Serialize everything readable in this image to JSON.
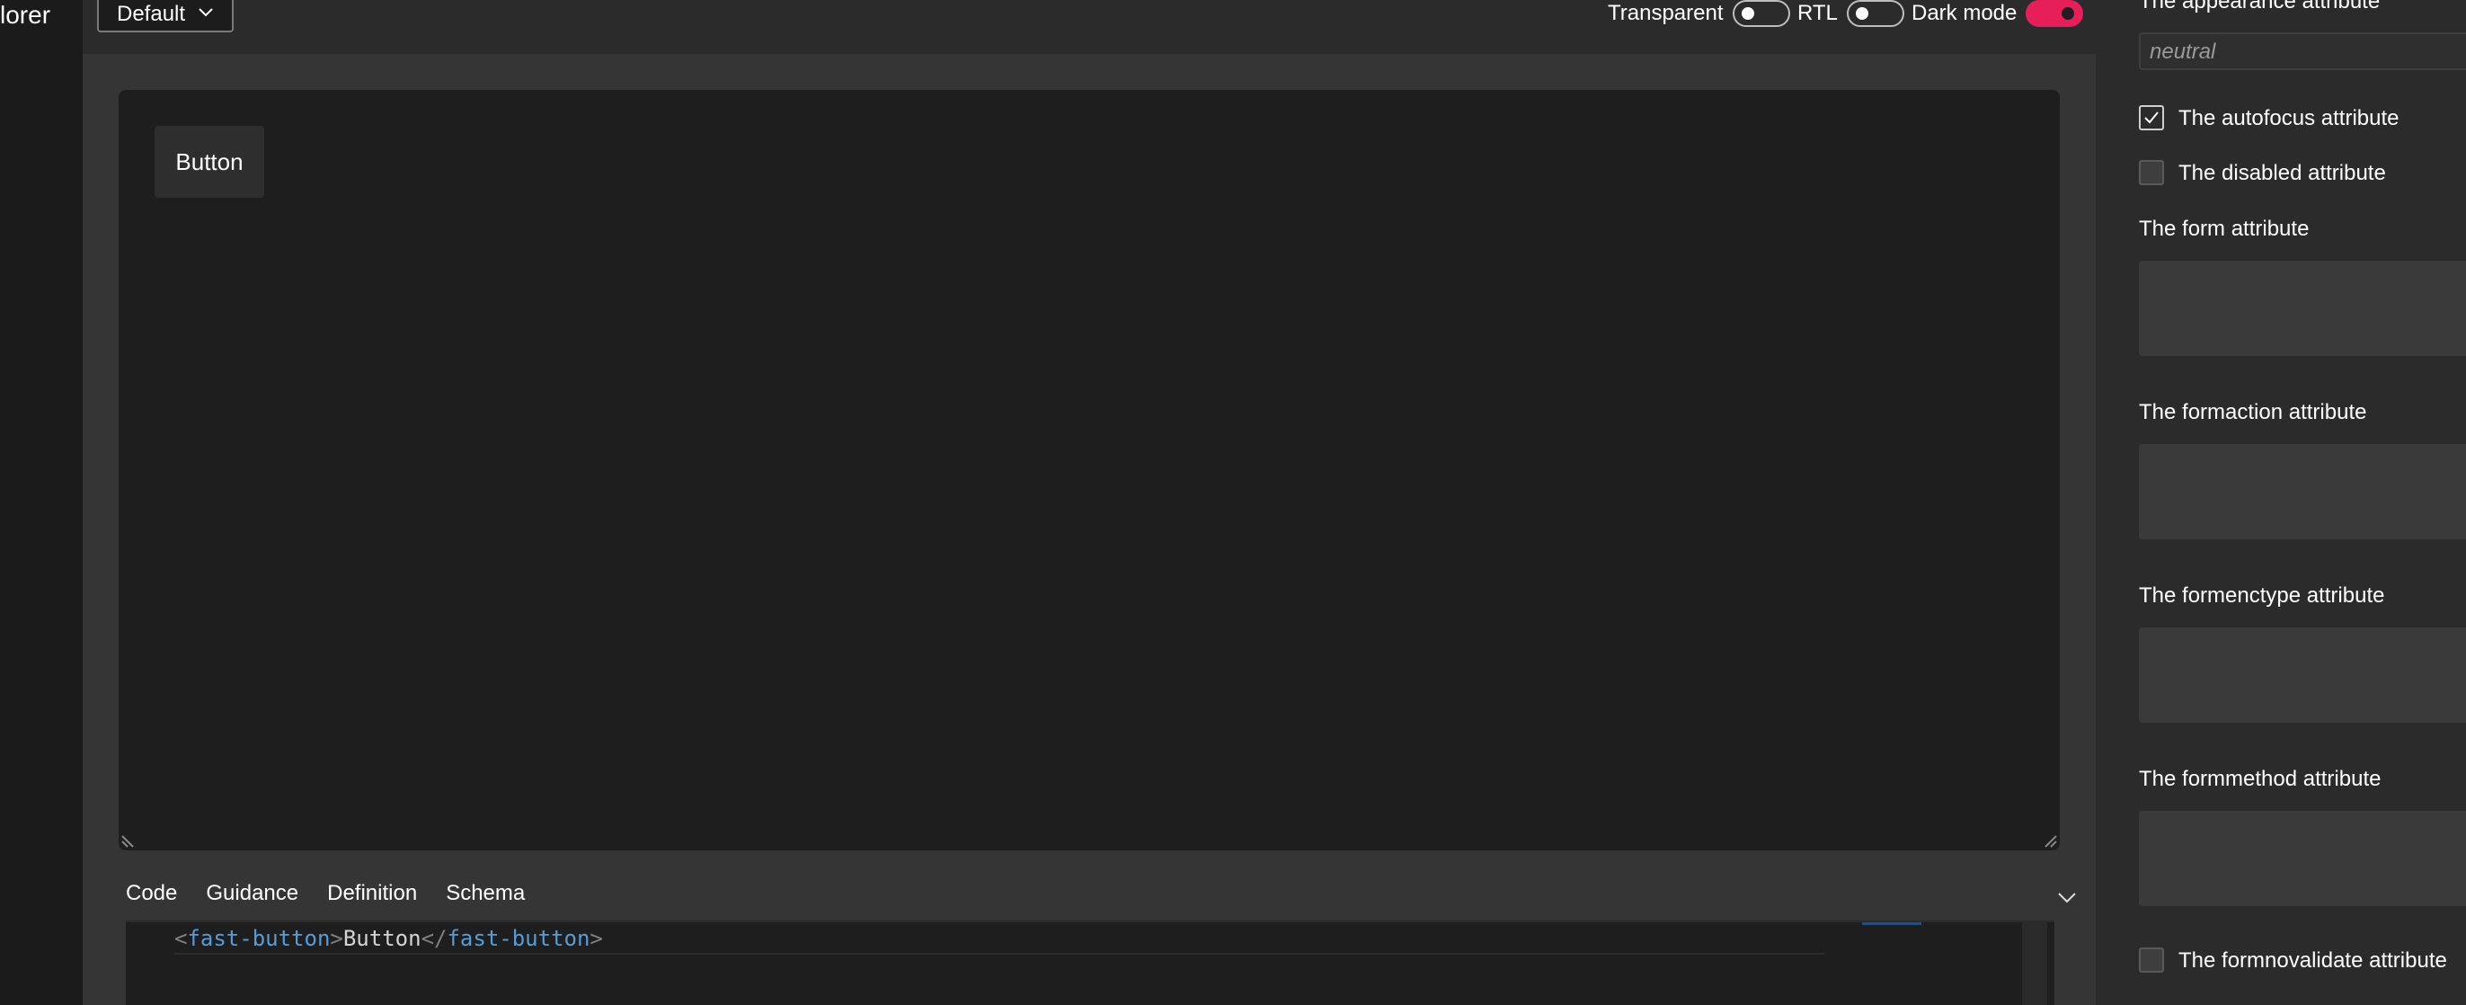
{
  "sidebar": {
    "brand_fragment": "lorer"
  },
  "toolbar": {
    "theme_select": {
      "value": "Default"
    },
    "toggles": {
      "transparent": {
        "label": "Transparent",
        "on": false
      },
      "rtl": {
        "label": "RTL",
        "on": false
      },
      "dark_mode": {
        "label": "Dark mode",
        "on": true
      }
    }
  },
  "preview": {
    "button_label": "Button"
  },
  "bottom_panel": {
    "tabs": [
      {
        "label": "Code",
        "active": true
      },
      {
        "label": "Guidance",
        "active": false
      },
      {
        "label": "Definition",
        "active": false
      },
      {
        "label": "Schema",
        "active": false
      }
    ],
    "code": {
      "open_bracket": "<",
      "open_tag": "fast-button",
      "close_bracket": ">",
      "text": "Button",
      "close_open_bracket": "</",
      "close_tag": "fast-button",
      "final_bracket": ">"
    }
  },
  "properties": {
    "appearance": {
      "label": "The appearance attribute",
      "placeholder": "neutral"
    },
    "autofocus": {
      "label": "The autofocus attribute",
      "checked": true
    },
    "disabled": {
      "label": "The disabled attribute",
      "checked": false
    },
    "form": {
      "label": "The form attribute"
    },
    "formaction": {
      "label": "The formaction attribute"
    },
    "formenctype": {
      "label": "The formenctype attribute"
    },
    "formmethod": {
      "label": "The formmethod attribute"
    },
    "formnovalidate": {
      "label": "The formnovalidate attribute",
      "checked": false
    }
  },
  "colors": {
    "accent": "#e61e5a",
    "canvas": "#1e1e1e",
    "surface": "#353535",
    "tag": "#569cd6"
  }
}
